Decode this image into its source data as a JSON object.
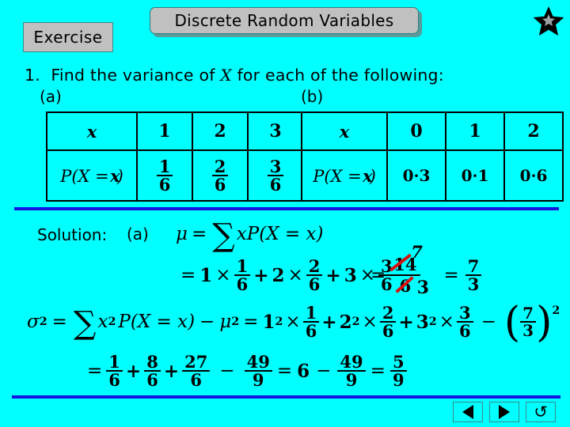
{
  "header": {
    "exercise_button": "Exercise",
    "title": "Discrete Random Variables",
    "star_icon": "star-icon"
  },
  "question": {
    "number": "1.",
    "text_before": "Find the variance of",
    "variable": "X",
    "text_after": "for each of the following:",
    "label_a": "(a)",
    "label_b": "(b)"
  },
  "table_a": {
    "row_header_x": "x",
    "row_header_p": "P(X = x)",
    "x_values": [
      "1",
      "2",
      "3"
    ],
    "probabilities": [
      {
        "num": "1",
        "den": "6"
      },
      {
        "num": "2",
        "den": "6"
      },
      {
        "num": "3",
        "den": "6"
      }
    ]
  },
  "table_b": {
    "row_header_x": "x",
    "row_header_p": "P(X = x)",
    "x_values": [
      "0",
      "1",
      "2"
    ],
    "probabilities": [
      "0·3",
      "0·1",
      "0·6"
    ]
  },
  "solution": {
    "label": "Solution:",
    "part": "(a)",
    "mean_definition": {
      "mu": "μ",
      "equals": "=",
      "sum": "∑",
      "expr": "xP(X = x)"
    },
    "mean_expansion": {
      "equals": "=",
      "terms": [
        {
          "coef": "1",
          "times": "×",
          "num": "1",
          "den": "6"
        },
        {
          "plus": "+",
          "coef": "2",
          "times": "×",
          "num": "2",
          "den": "6"
        },
        {
          "plus": "+",
          "coef": "3",
          "times": "×",
          "num": "3",
          "den": "6"
        }
      ]
    },
    "mean_result": {
      "equals": "=",
      "crossed_num": "14",
      "crossed_den": "6",
      "corrected_num": "7",
      "corrected_den": "3",
      "equals2": "=",
      "final_num": "7",
      "final_den": "3",
      "annotation_color": "#D81010"
    },
    "variance_definition": {
      "sigma": "σ",
      "sigma_power": "2",
      "equals": "=",
      "sum": "∑",
      "expr": "x",
      "expr_power": "2",
      "expr2": "P(X = x)",
      "minus": "−",
      "mu": "μ",
      "mu_power": "2"
    },
    "variance_expansion": {
      "equals": "=",
      "terms": [
        {
          "base": "1",
          "power": "2",
          "times": "×",
          "num": "1",
          "den": "6"
        },
        {
          "plus": "+",
          "base": "2",
          "power": "2",
          "times": "×",
          "num": "2",
          "den": "6"
        },
        {
          "plus": "+",
          "base": "3",
          "power": "2",
          "times": "×",
          "num": "3",
          "den": "6"
        }
      ],
      "minus": "−",
      "sub_num": "7",
      "sub_den": "3",
      "sub_power": "2"
    },
    "final_line": {
      "equals": "=",
      "t1_num": "1",
      "t1_den": "6",
      "plus1": "+",
      "t2_num": "8",
      "t2_den": "6",
      "plus2": "+",
      "t3_num": "27",
      "t3_den": "6",
      "minus": "−",
      "t4_num": "49",
      "t4_den": "9",
      "equals2": "=",
      "six": "6",
      "minus2": "−",
      "t5_num": "49",
      "t5_den": "9",
      "equals3": "=",
      "t6_num": "5",
      "t6_den": "9"
    }
  },
  "nav": {
    "previous": "previous-slide",
    "next": "next-slide",
    "return": "return-slide",
    "return_glyph": "↺"
  },
  "colors": {
    "background": "#00FFFF",
    "divider": "#1515E0",
    "button_face": "#C0C0C0",
    "annotation": "#D81010"
  }
}
